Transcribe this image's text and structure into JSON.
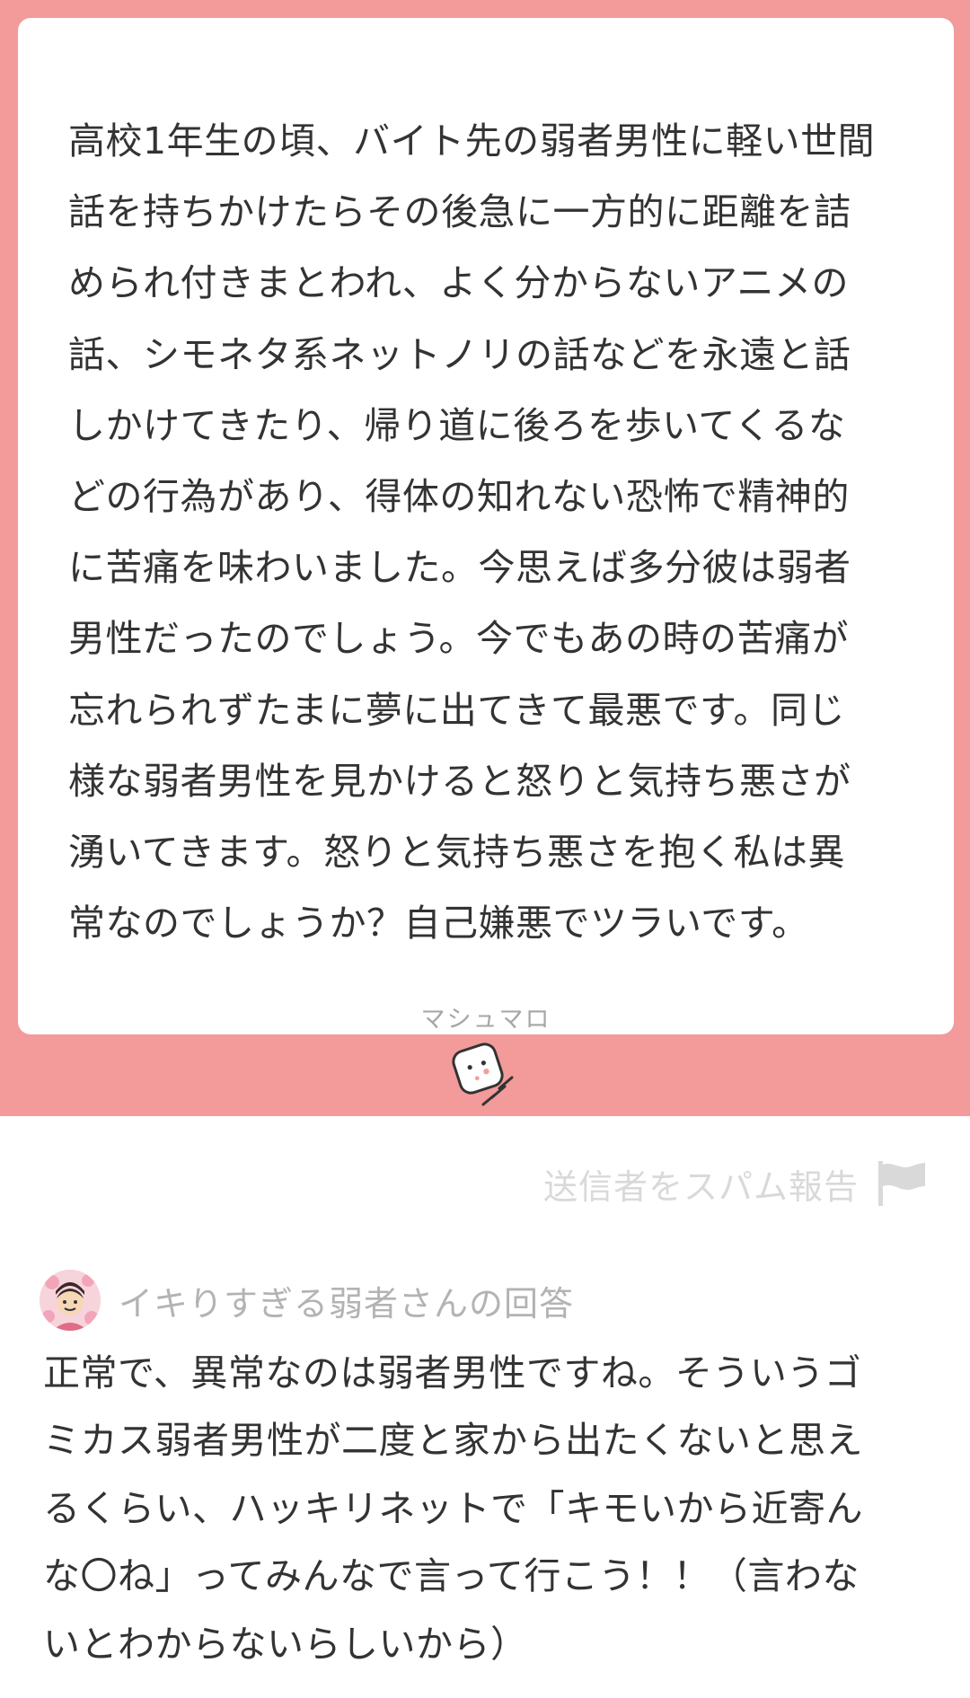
{
  "question": {
    "text": "高校1年生の頃、バイト先の弱者男性に軽い世間\n話を持ちかけたらその後急に一方的に距離を詰\nめられ付きまとわれ、よく分からないアニメの\n話、シモネタ系ネットノリの話などを永遠と話\nしかけてきたり、帰り道に後ろを歩いてくるな\nどの行為があり、得体の知れない恐怖で精神的\nに苦痛を味わいました。今思えば多分彼は弱者\n男性だったのでしょう。今でもあの時の苦痛が\n忘れられずたまに夢に出てきて最悪です。同じ\n様な弱者男性を見かけると怒りと気持ち悪さが\n湧いてきます。怒りと気持ち悪さを抱く私は異\n常なのでしょうか？自己嫌悪でツラいです。",
    "brand_label": "マシュマロ",
    "logo_icon": "marshmallow-logo-icon"
  },
  "report": {
    "label": "送信者をスパム報告",
    "icon": "flag-icon"
  },
  "answer": {
    "answerer_label": "イキりすぎる弱者さんの回答",
    "avatar_icon": "avatar",
    "text": "正常で、異常なのは弱者男性ですね。そういうゴ\nミカス弱者男性が二度と家から出たくないと思え\nるくらい、ハッキリネットで「キモいから近寄ん\nな〇ね」ってみんなで言って行こう！！（言わな\nいとわからないらしいから）"
  },
  "colors": {
    "accent_pink": "#f39a9b",
    "card_background": "#ffffff",
    "body_text": "#333333",
    "muted_text": "#b3b3b3",
    "report_text": "#d9d9d9"
  }
}
